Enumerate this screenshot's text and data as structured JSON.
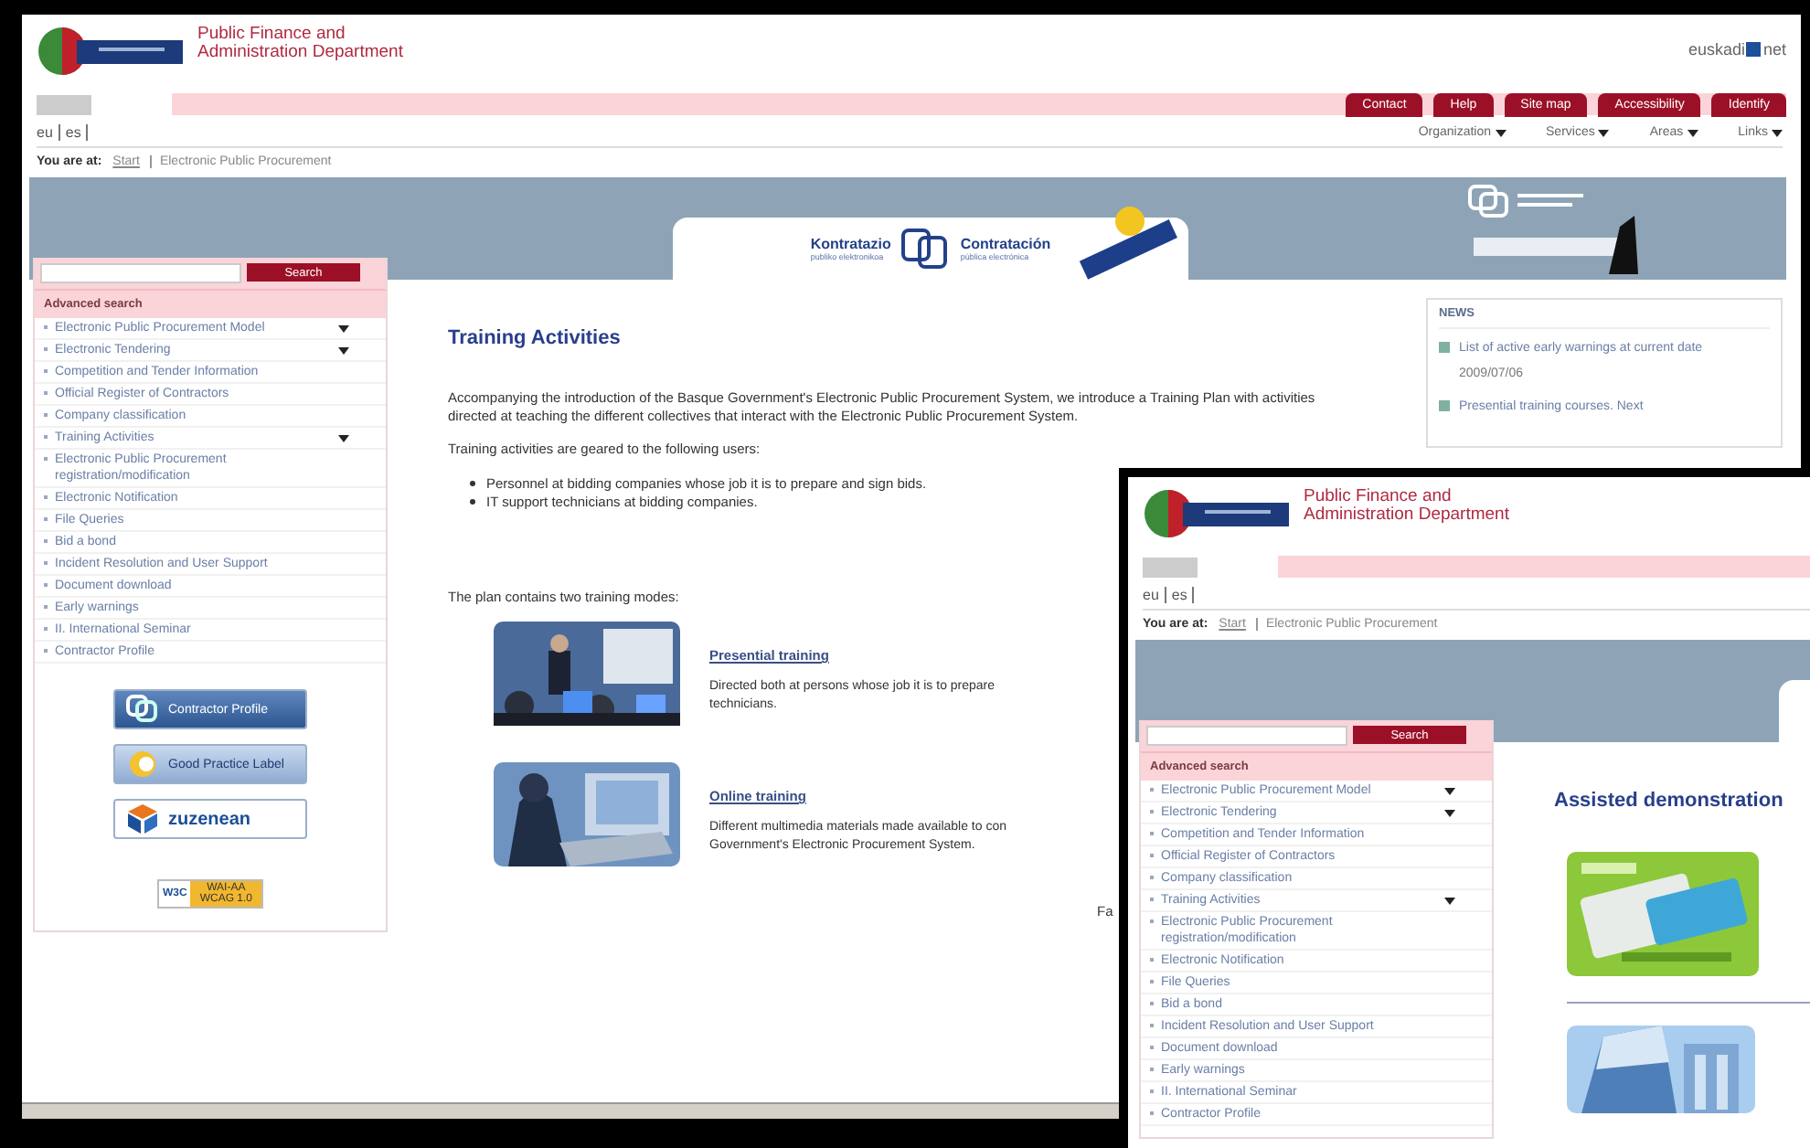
{
  "windows": [
    {
      "department": "Public Finance and Administration Department",
      "portal_logo": {
        "left": "euskadi",
        "right": "net"
      },
      "top_buttons": [
        "Contact",
        "Help",
        "Site map",
        "Accessibility",
        "Identify"
      ],
      "menus": [
        "Organization",
        "Services",
        "Areas",
        "Links"
      ],
      "languages": [
        "eu",
        "es"
      ],
      "breadcrumb": {
        "label": "You are at:",
        "items": [
          "Start",
          "Electronic Public Procurement"
        ]
      },
      "banner_logo": {
        "left": "Kontratazio",
        "left_sub": "publiko elektronikoa",
        "right": "Contratación",
        "right_sub": "pública electrónica"
      },
      "search_button": "Search",
      "advanced_search": "Advanced search",
      "sidebar_items": [
        {
          "label": "Electronic Public Procurement Model",
          "has_submenu": true
        },
        {
          "label": "Electronic Tendering",
          "has_submenu": true
        },
        {
          "label": "Competition and Tender Information",
          "has_submenu": false
        },
        {
          "label": "Official Register of Contractors",
          "has_submenu": false
        },
        {
          "label": "Company classification",
          "has_submenu": false
        },
        {
          "label": "Training Activities",
          "has_submenu": true
        },
        {
          "label": "Electronic Public Procurement registration/modification",
          "has_submenu": false
        },
        {
          "label": "Electronic Notification",
          "has_submenu": false
        },
        {
          "label": "File Queries",
          "has_submenu": false
        },
        {
          "label": "Bid a bond",
          "has_submenu": false
        },
        {
          "label": "Incident Resolution and User Support",
          "has_submenu": false
        },
        {
          "label": "Document download",
          "has_submenu": false
        },
        {
          "label": "Early warnings",
          "has_submenu": false
        },
        {
          "label": "II. International Seminar",
          "has_submenu": false
        },
        {
          "label": "Contractor Profile",
          "has_submenu": false
        }
      ],
      "side_banners": [
        {
          "kind": "contractor",
          "text": "Contractor Profile"
        },
        {
          "kind": "label",
          "text": "Good Practice Label"
        },
        {
          "kind": "zuzenean",
          "text": "zuzenean"
        }
      ],
      "w3c_badge": {
        "left": "W3C",
        "top": "WAI-AA",
        "bottom": "WCAG 1.0"
      },
      "title": "Training Activities",
      "paragraphs": [
        "Accompanying the introduction of the Basque Government's Electronic Public Procurement System, we introduce a Training Plan with activities directed at teaching the different collectives that interact with the Electronic Public Procurement System.",
        "Training activities are geared to the following users:"
      ],
      "bullets": [
        "Personnel at bidding companies whose job it is to prepare and sign bids.",
        "IT support technicians at bidding companies."
      ],
      "modes_intro": "The plan contains two training modes:",
      "modes": [
        {
          "kind": "picture",
          "link": "Presential training",
          "lines": [
            "Directed both at persons whose job it is to prepare",
            "technicians."
          ]
        },
        {
          "kind": "picture",
          "link": "Online training",
          "lines": [
            "Different multimedia materials made available to con",
            "Government's Electronic Procurement System."
          ]
        }
      ],
      "footer_fragment": "Fa",
      "news": {
        "heading": "NEWS",
        "items": [
          {
            "text": "List of active early warnings at current date",
            "date": "2009/07/06"
          },
          {
            "text": "Presential training courses. Next"
          }
        ]
      }
    },
    {
      "department": "Public Finance and Administration Department",
      "languages": [
        "eu",
        "es"
      ],
      "breadcrumb": {
        "label": "You are at:",
        "items": [
          "Start",
          "Electronic Public Procurement"
        ]
      },
      "search_button": "Search",
      "advanced_search": "Advanced search",
      "sidebar_items": [
        {
          "label": "Electronic Public Procurement Model",
          "has_submenu": true
        },
        {
          "label": "Electronic Tendering",
          "has_submenu": true
        },
        {
          "label": "Competition and Tender Information",
          "has_submenu": false
        },
        {
          "label": "Official Register of Contractors",
          "has_submenu": false
        },
        {
          "label": "Company classification",
          "has_submenu": false
        },
        {
          "label": "Training Activities",
          "has_submenu": true
        },
        {
          "label": "Electronic Public Procurement registration/modification",
          "has_submenu": false
        },
        {
          "label": "Electronic Notification",
          "has_submenu": false
        },
        {
          "label": "File Queries",
          "has_submenu": false
        },
        {
          "label": "Bid a bond",
          "has_submenu": false
        },
        {
          "label": "Incident Resolution and User Support",
          "has_submenu": false
        },
        {
          "label": "Document download",
          "has_submenu": false
        },
        {
          "label": "Early warnings",
          "has_submenu": false
        },
        {
          "label": "II. International Seminar",
          "has_submenu": false
        },
        {
          "label": "Contractor Profile",
          "has_submenu": false
        }
      ],
      "title": "Assisted demonstration",
      "demos": [
        {
          "kind": "picture"
        },
        {
          "kind": "picture"
        }
      ]
    }
  ]
}
